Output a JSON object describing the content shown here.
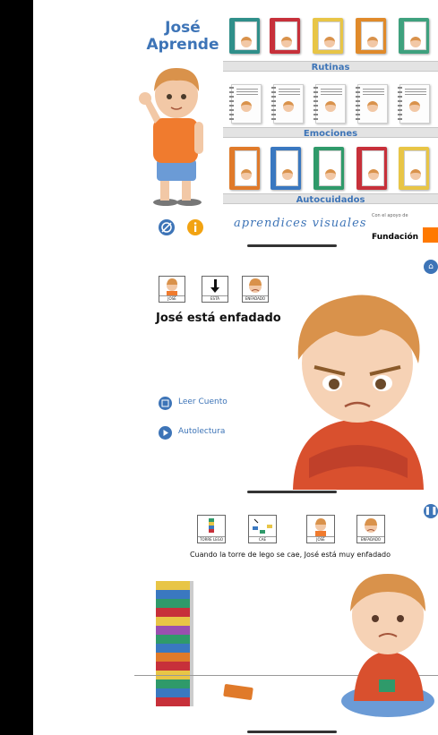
{
  "screen1": {
    "app_title": "José\nAprende",
    "shelves": [
      {
        "label": "Rutinas",
        "book_colors": [
          "#2f8f8a",
          "#c7303a",
          "#e8c546",
          "#e08a2a",
          "#3ea17e"
        ]
      },
      {
        "label": "Emociones"
      },
      {
        "label": "Autocuidados",
        "book_colors": [
          "#e07a2a",
          "#3a78c0",
          "#2f9a6a",
          "#c7303a",
          "#e8c546"
        ]
      }
    ],
    "footer": {
      "aprendices": "aprendices visuales",
      "fundacion_small": "Con el apoyo de",
      "fundacion": "Fundación",
      "orange_color": "#ff7900"
    }
  },
  "screen2": {
    "pictograms": [
      "JOSÉ",
      "ESTÁ",
      "ENFADADO"
    ],
    "sentence": "José está enfadado",
    "menu": [
      {
        "label": "Leer Cuento",
        "icon": "book-icon"
      },
      {
        "label": "Autolectura",
        "icon": "play-icon"
      }
    ],
    "home_icon": "home-icon"
  },
  "screen3": {
    "pictograms": [
      "TORRE LEGO",
      "CAE",
      "JOSÉ",
      "ENFADADO"
    ],
    "caption": "Cuando la torre de lego se cae, José está muy enfadado",
    "pause_icon": "pause-icon"
  },
  "colors": {
    "accent": "#3d74b7",
    "hair": "#d9924b",
    "shirt": "#f07b2e",
    "hoodie": "#d9502e"
  }
}
